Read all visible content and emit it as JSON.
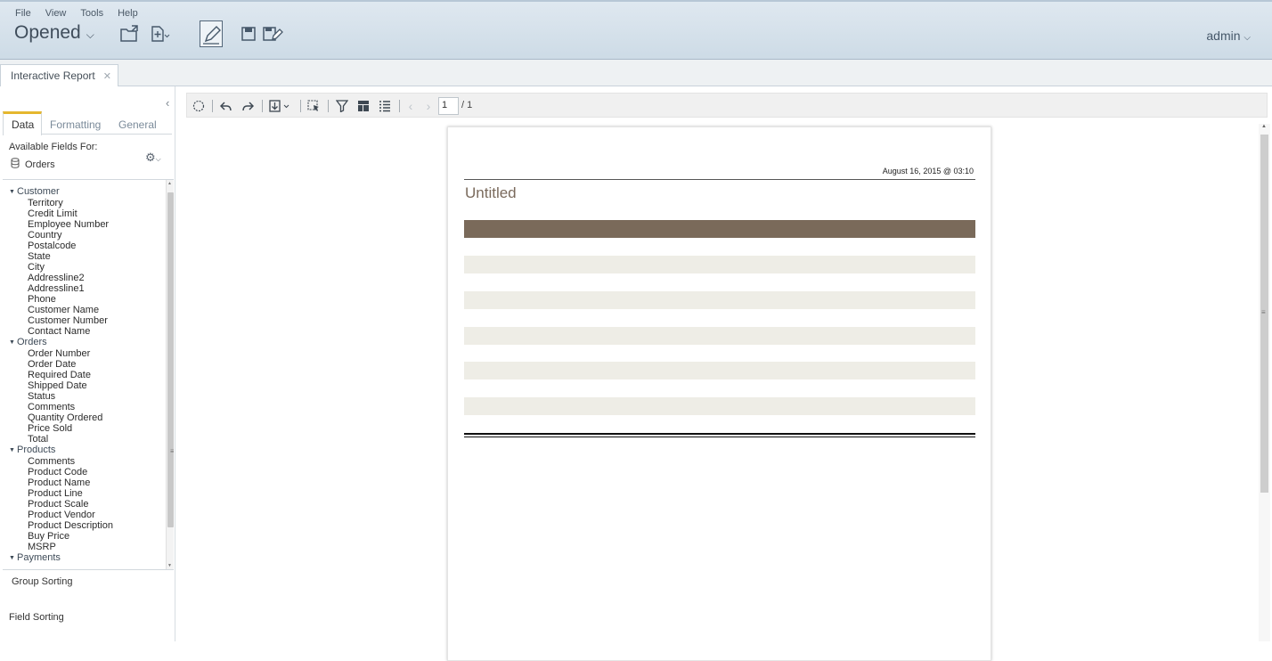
{
  "menu": [
    "File",
    "View",
    "Tools",
    "Help"
  ],
  "header": {
    "perspective": "Opened",
    "user": "admin"
  },
  "tabs": [
    {
      "label": "Interactive Report"
    }
  ],
  "left_panel": {
    "tabs": [
      "Data",
      "Formatting",
      "General"
    ],
    "available_label": "Available Fields For:",
    "source": "Orders",
    "groups": [
      {
        "name": "Customer",
        "fields": [
          "Territory",
          "Credit Limit",
          "Employee Number",
          "Country",
          "Postalcode",
          "State",
          "City",
          "Addressline2",
          "Addressline1",
          "Phone",
          "Customer Name",
          "Customer Number",
          "Contact Name"
        ]
      },
      {
        "name": "Orders",
        "fields": [
          "Order Number",
          "Order Date",
          "Required Date",
          "Shipped Date",
          "Status",
          "Comments",
          "Quantity Ordered",
          "Price Sold",
          "Total"
        ]
      },
      {
        "name": "Products",
        "fields": [
          "Comments",
          "Product Code",
          "Product Name",
          "Product Line",
          "Product Scale",
          "Product Vendor",
          "Product Description",
          "Buy Price",
          "MSRP"
        ]
      },
      {
        "name": "Payments",
        "fields": []
      }
    ],
    "group_sorting": "Group Sorting",
    "field_sorting": "Field Sorting"
  },
  "toolbar": {
    "page_value": "1",
    "page_total": "/ 1"
  },
  "report": {
    "date": "August 16, 2015 @ 03:10",
    "title": "Untitled"
  }
}
